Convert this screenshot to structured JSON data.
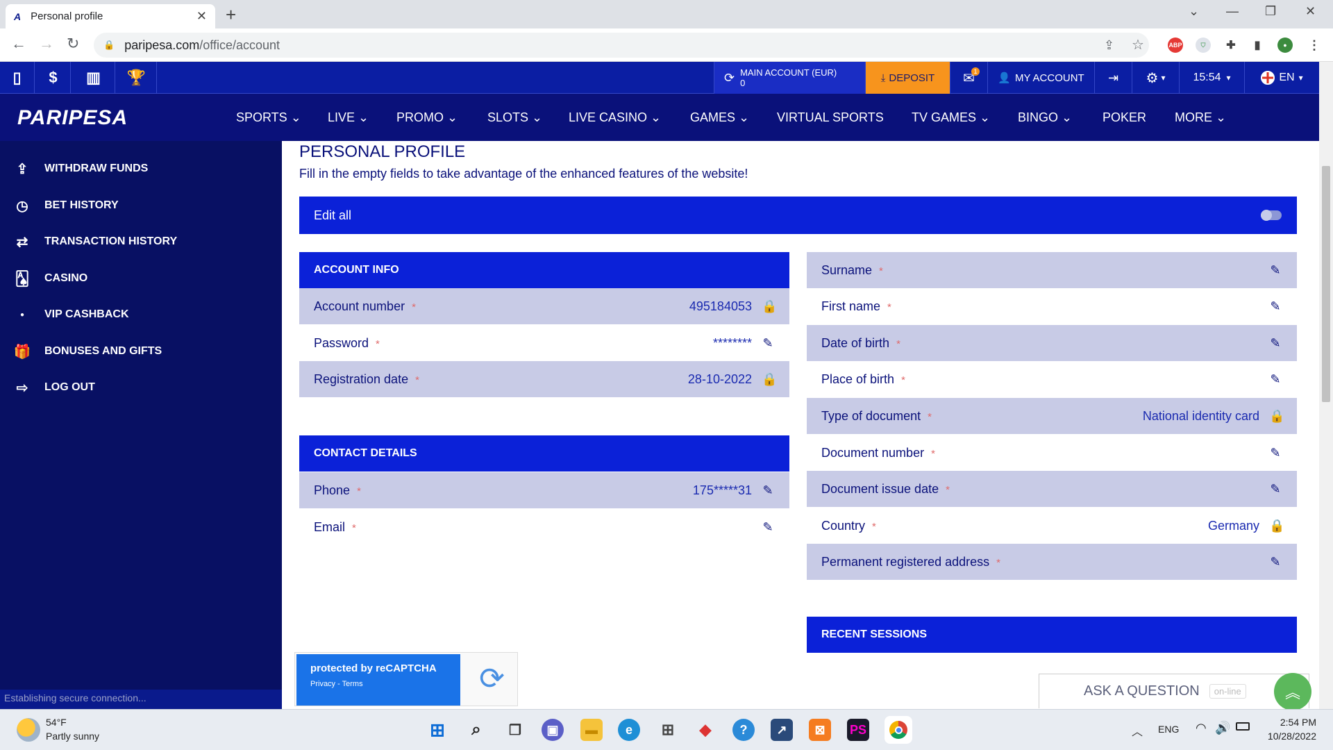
{
  "browser": {
    "tab_title": "Personal profile",
    "url_host": "paripesa.com",
    "url_path": "/office/account"
  },
  "topstrip": {
    "main_account_label": "MAIN ACCOUNT (EUR)",
    "balance": "0",
    "deposit": "DEPOSIT",
    "my_account": "MY ACCOUNT",
    "time": "15:54",
    "language": "EN",
    "mail_badge": "1"
  },
  "logo": "PARIPESA",
  "menu": [
    "SPORTS",
    "LIVE",
    "PROMO",
    "SLOTS",
    "LIVE CASINO",
    "GAMES",
    "VIRTUAL SPORTS",
    "TV GAMES",
    "BINGO",
    "POKER",
    "MORE"
  ],
  "sidebar": {
    "items": [
      {
        "label": "WITHDRAW FUNDS",
        "icon": "upload-icon"
      },
      {
        "label": "BET HISTORY",
        "icon": "clock-icon"
      },
      {
        "label": "TRANSACTION HISTORY",
        "icon": "arrows-icon"
      },
      {
        "label": "CASINO",
        "icon": "cards-icon"
      },
      {
        "label": "VIP CASHBACK",
        "icon": "dot-icon"
      },
      {
        "label": "BONUSES AND GIFTS",
        "icon": "gift-icon"
      },
      {
        "label": "LOG OUT",
        "icon": "logout-icon"
      }
    ],
    "status": "Establishing secure connection..."
  },
  "profile": {
    "title": "PERSONAL PROFILE",
    "subtitle": "Fill in the empty fields to take advantage of the enhanced features of the website!",
    "edit_all": "Edit all",
    "account_info": {
      "header": "ACCOUNT INFO",
      "account_number_label": "Account number",
      "account_number": "495184053",
      "password_label": "Password",
      "password": "********",
      "registration_label": "Registration date",
      "registration_date": "28-10-2022"
    },
    "contact": {
      "header": "CONTACT DETAILS",
      "phone_label": "Phone",
      "phone": "175*****31",
      "email_label": "Email"
    },
    "personal": {
      "surname": "Surname",
      "first_name": "First name",
      "dob": "Date of birth",
      "pob": "Place of birth",
      "doc_type_label": "Type of document",
      "doc_type": "National identity card",
      "doc_number": "Document number",
      "doc_issue": "Document issue date",
      "country_label": "Country",
      "country": "Germany",
      "address": "Permanent registered address"
    },
    "recent_sessions": "RECENT SESSIONS",
    "required_mark": "*"
  },
  "captcha": {
    "title": "protected by reCAPTCHA",
    "links": "Privacy - Terms"
  },
  "ask": {
    "label": "ASK A QUESTION",
    "status": "on-line"
  },
  "taskbar": {
    "weather_temp": "54°F",
    "weather_desc": "Partly sunny",
    "lang": "ENG",
    "time": "2:54 PM",
    "date": "10/28/2022"
  },
  "colors": {
    "brand_blue": "#0b21d8",
    "nav_dark": "#0a117a",
    "deposit_orange": "#f7941d",
    "shade": "#c8cbe6"
  }
}
